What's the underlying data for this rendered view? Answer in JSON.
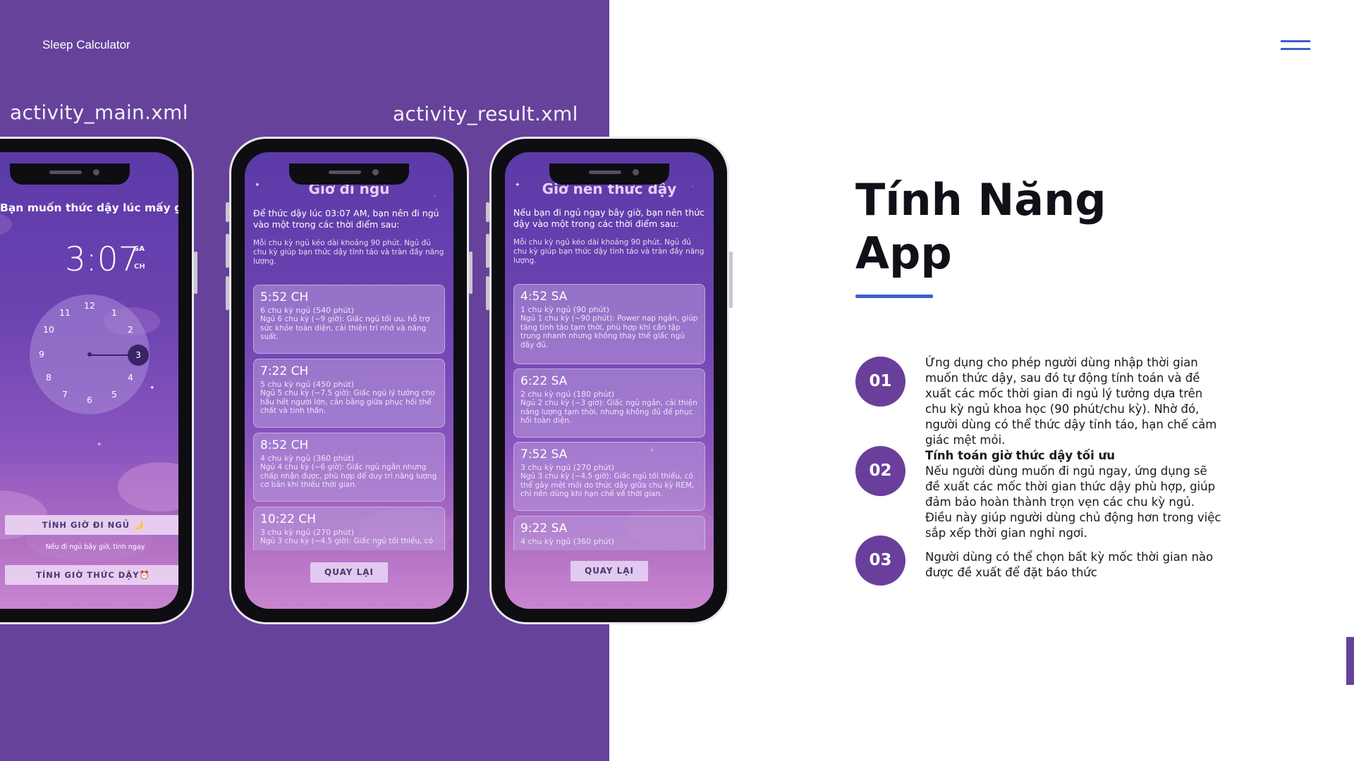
{
  "header": {
    "brand": "Sleep Calculator"
  },
  "labels": {
    "main_file": "activity_main.xml",
    "result_file": "activity_result.xml"
  },
  "main_screen": {
    "question": "Bạn muốn thức dậy lúc mấy giờ?",
    "time": "3:07",
    "am": "SA",
    "pm": "CH",
    "selected_hour": "3",
    "dial_numbers": [
      "12",
      "1",
      "2",
      "3",
      "4",
      "5",
      "6",
      "7",
      "8",
      "9",
      "10",
      "11"
    ],
    "btn_sleep": "TÍNH GIỜ ĐI NGỦ 🌙",
    "hint": "Nếu đi ngủ bây giờ, tính ngay",
    "btn_wake": "TÍNH GIỜ THỨC DẬY⏰"
  },
  "bedtime_screen": {
    "title": "Giờ đi ngủ",
    "intro": "Để thức dậy lúc 03:07 AM, bạn nên đi ngủ vào một trong các thời điểm sau:",
    "note": "Mỗi chu kỳ ngủ kéo dài khoảng 90 phút. Ngủ đủ chu kỳ giúp bạn thức dậy tỉnh táo và tràn đầy năng lượng.",
    "cards": [
      {
        "time": "5:52 CH",
        "sub": "6 chu kỳ ngủ (540 phút)",
        "desc": "Ngủ 6 chu kỳ (~9 giờ): Giấc ngủ tối ưu, hỗ trợ sức khỏe toàn diện, cải thiện trí nhớ và năng suất."
      },
      {
        "time": "7:22 CH",
        "sub": "5 chu kỳ ngủ (450 phút)",
        "desc": "Ngủ 5 chu kỳ (~7.5 giờ): Giấc ngủ lý tưởng cho hầu hết người lớn, cân bằng giữa phục hồi thể chất và tinh thần."
      },
      {
        "time": "8:52 CH",
        "sub": "4 chu kỳ ngủ (360 phút)",
        "desc": "Ngủ 4 chu kỳ (~6 giờ): Giấc ngủ ngắn nhưng chấp nhận được, phù hợp để duy trì năng lượng cơ bản khi thiếu thời gian."
      },
      {
        "time": "10:22 CH",
        "sub": "3 chu kỳ ngủ (270 phút)",
        "desc": "Ngủ 3 chu kỳ (~4.5 giờ): Giấc ngủ tối thiểu, có"
      }
    ],
    "back": "QUAY LẠI"
  },
  "wake_screen": {
    "title": "Giờ nên thức dậy",
    "intro": "Nếu bạn đi ngủ ngay bây giờ, bạn nên thức dậy vào một trong các thời điểm sau:",
    "note": "Mỗi chu kỳ ngủ kéo dài khoảng 90 phút. Ngủ đủ chu kỳ giúp bạn thức dậy tỉnh táo và tràn đầy năng lượng.",
    "cards": [
      {
        "time": "4:52 SA",
        "sub": "1 chu kỳ ngủ (90 phút)",
        "desc": "Ngủ 1 chu kỳ (~90 phút): Power nap ngắn, giúp tăng tỉnh táo tạm thời, phù hợp khi cần tập trung nhanh nhưng không thay thế giấc ngủ đầy đủ."
      },
      {
        "time": "6:22 SA",
        "sub": "2 chu kỳ ngủ (180 phút)",
        "desc": "Ngủ 2 chu kỳ (~3 giờ): Giấc ngủ ngắn, cải thiện năng lượng tạm thời, nhưng không đủ để phục hồi toàn diện."
      },
      {
        "time": "7:52 SA",
        "sub": "3 chu kỳ ngủ (270 phút)",
        "desc": "Ngủ 3 chu kỳ (~4.5 giờ): Giấc ngủ tối thiểu, có thể gây mệt mỏi do thức dậy giữa chu kỳ REM, chỉ nên dùng khi hạn chế về thời gian."
      },
      {
        "time": "9:22 SA",
        "sub": "4 chu kỳ ngủ (360 phút)",
        "desc": ""
      }
    ],
    "back": "QUAY LẠI"
  },
  "features": {
    "title_line1": "Tính Năng",
    "title_line2": "App",
    "items": [
      {
        "num": "01",
        "heading": "",
        "text": "Ứng dụng cho phép người dùng nhập thời gian muốn thức dậy, sau đó tự động tính toán và đề xuất các mốc thời gian đi ngủ lý tưởng dựa trên chu kỳ ngủ khoa học (90 phút/chu kỳ). Nhờ đó, người dùng có thể thức dậy tỉnh táo, hạn chế cảm giác mệt mỏi."
      },
      {
        "num": "02",
        "heading": "Tính toán giờ thức dậy tối ưu",
        "text": "Nếu người dùng muốn đi ngủ ngay, ứng dụng sẽ đề xuất các mốc thời gian thức dậy phù hợp, giúp đảm bảo hoàn thành trọn vẹn các chu kỳ ngủ. Điều này giúp người dùng chủ động hơn trong việc sắp xếp thời gian nghỉ ngơi."
      },
      {
        "num": "03",
        "heading": "",
        "text": "Người dùng có thể chọn bất kỳ mốc thời gian nào được đề xuất để đặt báo thức"
      }
    ]
  },
  "colors": {
    "panel": "#66429a",
    "accent": "#3e5fc9",
    "circle": "#6a3f9c"
  },
  "icons": {
    "menu": "hamburger-menu-icon"
  }
}
